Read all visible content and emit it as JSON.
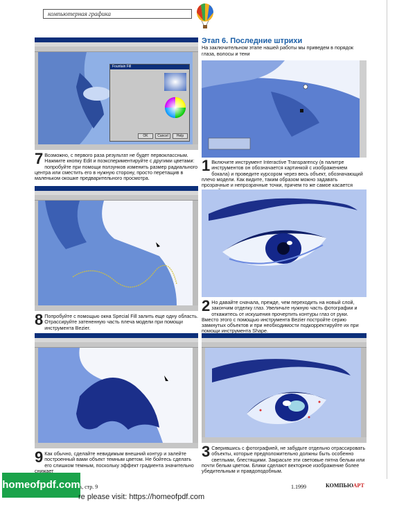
{
  "header": {
    "section_label": "компьютерная графика"
  },
  "stage": {
    "title": "Этап 6. Последние штрихи",
    "intro": "На заключительном этапе нашей работы мы приведем в порядок глаза, волосы и тени"
  },
  "captions": {
    "c7": {
      "num": "7",
      "text": "Возможно, с первого раза результат не будет первоклассным. Нажмите кнопку Edit и поэкспериментируйте с другими цветами: попробуйте при помощи ползунков изменить размер радиального центра или сместить его в нужную сторону, просто перетащив в маленьком окошке предварительного просмотра."
    },
    "c8": {
      "num": "8",
      "text": "Попробуйте с помощью окна Special Fill залить еще одну область. Отрассируйте затененную часть плеча модели при помощи инструмента Bezier."
    },
    "c9": {
      "num": "9",
      "text": "Как обычно, сделайте невидимым внешний контур и залейте построенный вами объект темным цветом. Не бойтесь сделать его слишком темным, поскольку эффект градиента значительно снижает"
    },
    "r1": {
      "num": "1",
      "text": "Включите инструмент Interactive Transparency (в палитре инструментов он обозначается картинкой с изображением бокала) и проведите курсором через весь объект, обозначающий плечо модели. Как видите, таким образом можно задавать прозрачные и непрозрачные точки, причем то же самое касается средней точки градиента."
    },
    "r2": {
      "num": "2",
      "text": "Но давайте сначала, прежде, чем переходить на новый слой, закончим отделку глаз. Увеличьте нужную часть фотографии и откажитесь от искушения прочертить контуры глаз от руки. Вместо этого с помощью инструмента Bezier постройте серию замкнутых объектов и при необходимости подкорректируйте их при помощи инструмента Shape."
    },
    "r3": {
      "num": "3",
      "text": "Сверившись с фотографией, не забудьте отдельно отрассировать объекты, которые предположительно должны быть особенно светлыми, блестящими. Закрасьте эти световые пятна белым или почти белым цветом. Блики сделают векторное изображение более убедительным и правдоподобным."
    }
  },
  "dialog": {
    "title": "Fountain Fill",
    "ok": "OK",
    "cancel": "Cancel",
    "help": "Help"
  },
  "shot_titles": {
    "s1": "CorelDRAW 8",
    "s2": "CorelDRAW 8 - [Graphic1.cdr]",
    "s3": "CorelDRAW 8"
  },
  "footer": {
    "left": "s, стр. 9",
    "right": "1.1999",
    "logo_main": "КОМПЬЮ",
    "logo_accent": "АРТ"
  },
  "promo": {
    "box": "homeofpdf.com",
    "text": "re please visit: https://homeofpdf.com"
  },
  "colors": {
    "accent": "#1a5ea6",
    "photo_blue": "#7aa0dc",
    "dark_fill": "#1b2f8a",
    "promo_green": "#1aa34a"
  }
}
